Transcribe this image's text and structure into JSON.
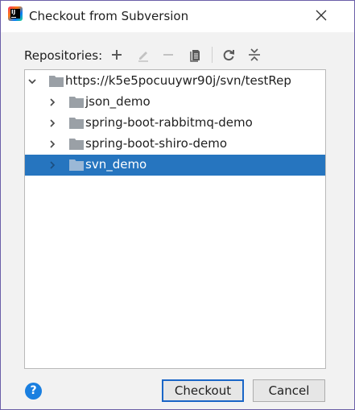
{
  "window": {
    "title": "Checkout from Subversion"
  },
  "toolbar": {
    "label": "Repositories:",
    "buttons": [
      "add-icon",
      "edit-icon",
      "remove-icon",
      "browse-icon",
      "refresh-icon",
      "collapse-icon"
    ]
  },
  "tree": {
    "root": "https://k5e5pocuuywr90j/svn/testRep",
    "children": [
      {
        "label": "json_demo",
        "selected": false
      },
      {
        "label": "spring-boot-rabbitmq-demo",
        "selected": false
      },
      {
        "label": "spring-boot-shiro-demo",
        "selected": false
      },
      {
        "label": "svn_demo",
        "selected": true
      }
    ]
  },
  "footer": {
    "help": "?",
    "checkout": "Checkout",
    "cancel": "Cancel"
  },
  "colors": {
    "selection": "#2675bf",
    "folder": "#9aa0a6",
    "primary_border": "#1a66c7",
    "help": "#1a7fe0"
  }
}
